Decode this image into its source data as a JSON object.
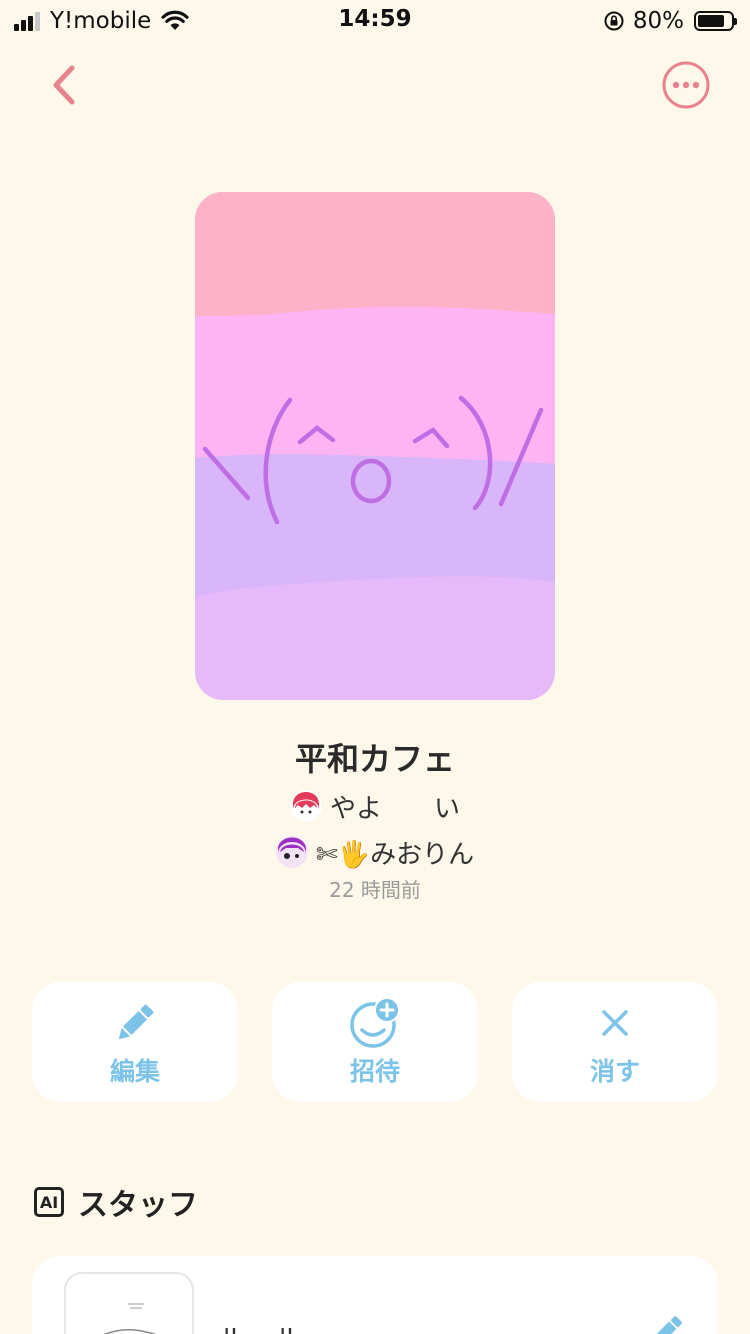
{
  "status_bar": {
    "carrier": "Y!mobile",
    "time": "14:59",
    "battery": "80%"
  },
  "room": {
    "title": "平和カフェ",
    "members": [
      {
        "name": "やよ　　い"
      },
      {
        "name": "✄🖐みおりん"
      }
    ],
    "updated": "22 時間前"
  },
  "actions": {
    "edit": "編集",
    "invite": "招待",
    "delete": "消す"
  },
  "staff": {
    "section_title": "スタッフ",
    "ai_badge": "AI",
    "first_name": "ル　ル"
  },
  "colors": {
    "background": "#fdf8ea",
    "accent_pink": "#e8838d",
    "accent_blue": "#7cc3ea"
  }
}
